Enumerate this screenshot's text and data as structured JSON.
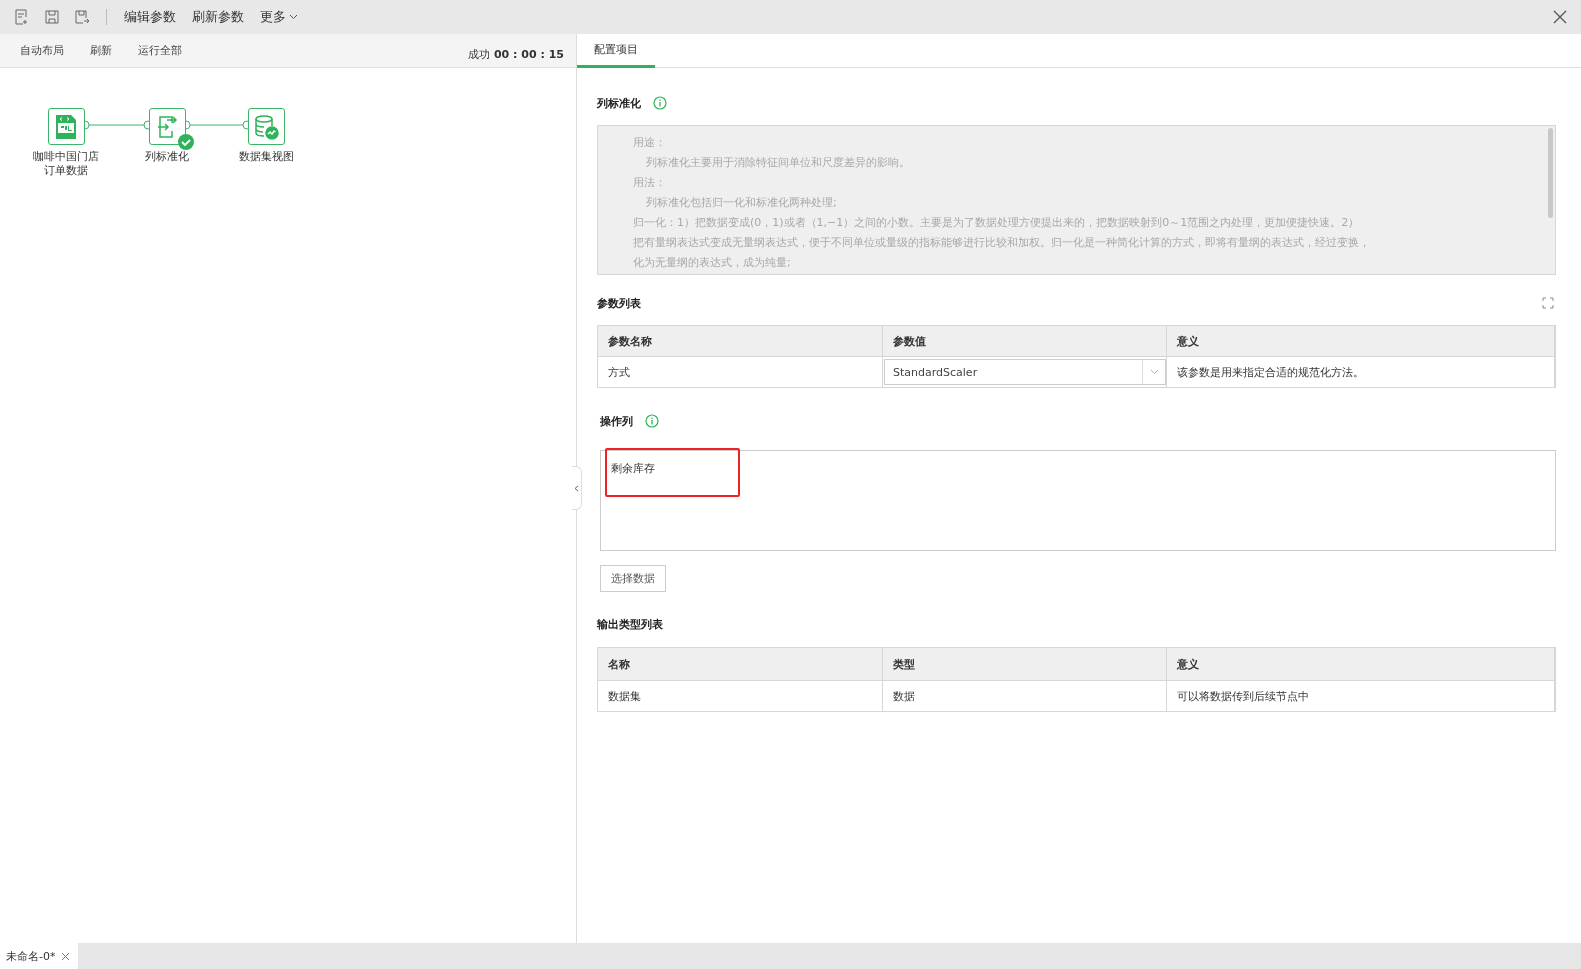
{
  "toolbar": {
    "actions": [
      "编辑参数",
      "刷新参数"
    ],
    "more": "更多"
  },
  "canvas_toolbar": {
    "actions": [
      "自动布局",
      "刷新",
      "运行全部"
    ],
    "status": "成功",
    "time": "00 : 00 : 15"
  },
  "nodes": [
    {
      "kind": "sql",
      "label": [
        "咖啡中国门店",
        "订单数据"
      ],
      "done": false
    },
    {
      "kind": "transform",
      "label": [
        "列标准化"
      ],
      "done": true
    },
    {
      "kind": "dataset",
      "label": [
        "数据集视图"
      ],
      "done": false
    }
  ],
  "tabs": [
    {
      "label": "配置项目",
      "selected": true
    }
  ],
  "description": {
    "title": "列标准化",
    "lines": [
      {
        "text": "用途：",
        "indented": false
      },
      {
        "text": "列标准化主要用于消除特征间单位和尺度差异的影响。",
        "indented": true
      },
      {
        "text": "用法：",
        "indented": false
      },
      {
        "text": "列标准化包括归一化和标准化两种处理;",
        "indented": true
      },
      {
        "text": "归一化：1）把数据变成(0，1)或者（1,−1）之间的小数。主要是为了数据处理方便提出来的，把数据映射到0～1范围之内处理，更加便捷快速。2）",
        "indented": false
      },
      {
        "text": "把有量纲表达式变成无量纲表达式，便于不同单位或量级的指标能够进行比较和加权。归一化是一种简化计算的方式，即将有量纲的表达式，经过变换，",
        "indented": false
      },
      {
        "text": "化为无量纲的表达式，成为纯量;",
        "indented": false
      }
    ]
  },
  "params": {
    "title": "参数列表",
    "columns": [
      "参数名称",
      "参数值",
      "意义"
    ],
    "rows": [
      {
        "name": "方式",
        "value": "StandardScaler",
        "meaning": "该参数是用来指定合适的规范化方法。"
      }
    ]
  },
  "operation_columns": {
    "title": "操作列",
    "items": [
      {
        "text": "剩余库存",
        "highlighted": true
      }
    ],
    "button": "选择数据"
  },
  "outputs": {
    "title": "输出类型列表",
    "columns": [
      "名称",
      "类型",
      "意义"
    ],
    "rows": [
      [
        "数据集",
        "数据",
        "可以将数据传到后续节点中"
      ]
    ]
  },
  "doc_tabs": [
    {
      "label": "未命名-0*",
      "selected": true
    }
  ]
}
